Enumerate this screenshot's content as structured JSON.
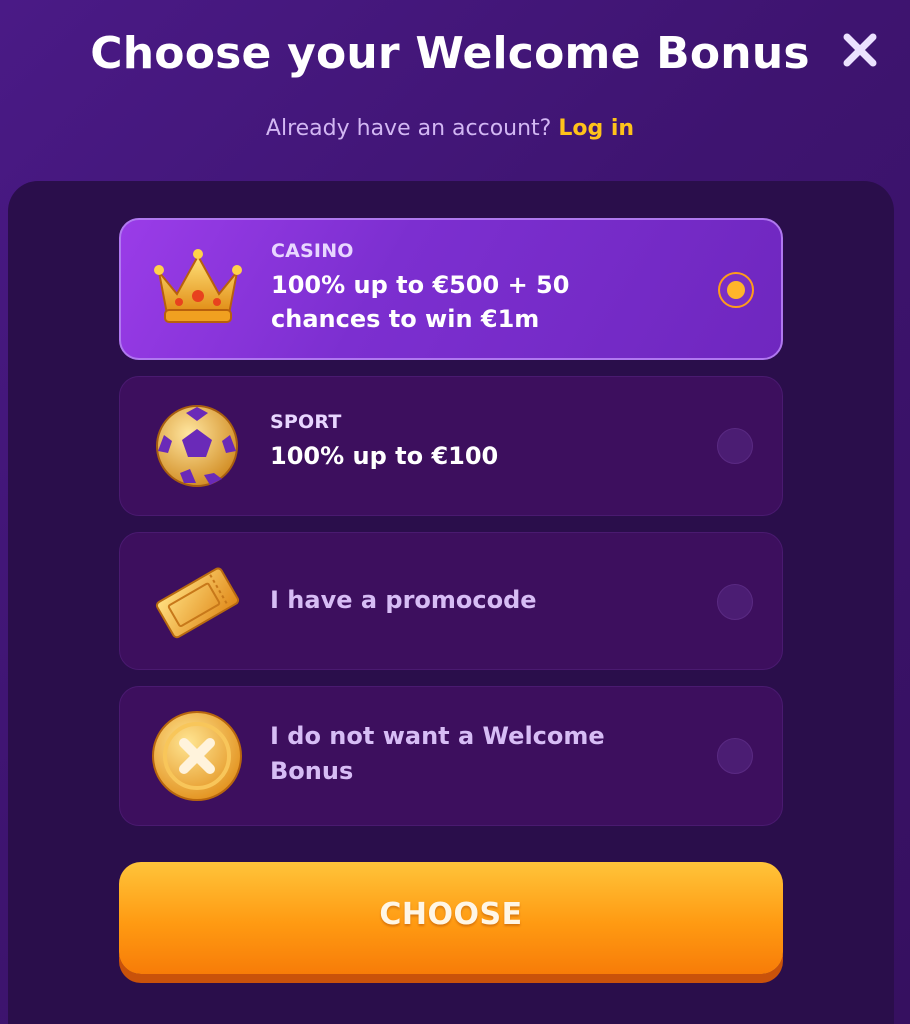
{
  "header": {
    "title": "Choose your Welcome Bonus",
    "account_prompt": "Already have an account? ",
    "login_label": "Log in",
    "close_icon": "close-icon"
  },
  "options": [
    {
      "category": "CASINO",
      "line1": "100% up to €500 + 50",
      "line2": "chances to win €1m",
      "icon": "crown-icon",
      "selected": true
    },
    {
      "category": "SPORT",
      "line1": "100% up to €100",
      "icon": "soccer-ball-icon",
      "selected": false
    },
    {
      "label": "I have a promocode",
      "icon": "ticket-icon",
      "selected": false
    },
    {
      "line1": "I do not want a Welcome",
      "line2": "Bonus",
      "icon": "coin-cross-icon",
      "selected": false
    }
  ],
  "choose_button": {
    "label": "CHOOSE"
  },
  "colors": {
    "accent": "#ffc21a",
    "selected_card": "#8a34dc",
    "card": "#3d0f5e",
    "button": "#ff9a12"
  }
}
